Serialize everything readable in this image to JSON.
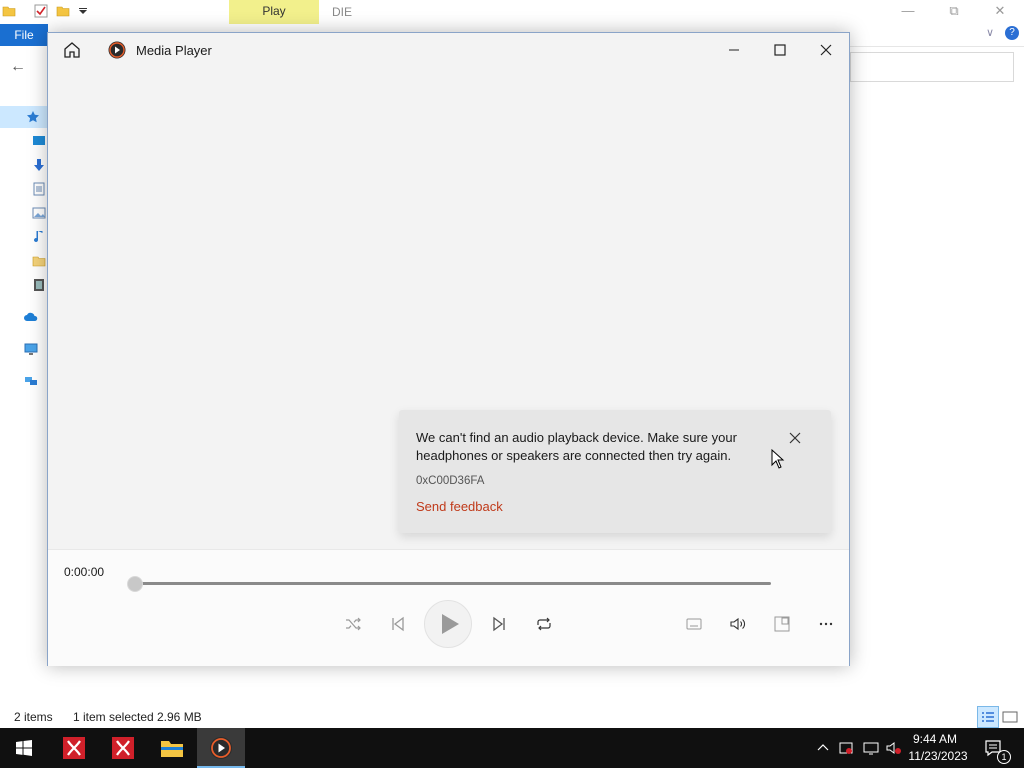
{
  "explorer": {
    "ribbon_context_tab": "Play",
    "title": "DIE",
    "file_tab": "File",
    "status": {
      "item_count": "2 items",
      "selection": "1 item selected",
      "size": "2.96 MB"
    }
  },
  "media_player": {
    "title": "Media Player",
    "error": {
      "message": "We can't find an audio playback device. Make sure your headphones or speakers are connected then try again.",
      "code": "0xC00D36FA",
      "feedback_link": "Send feedback"
    },
    "playback": {
      "time": "0:00:00",
      "progress": 0
    }
  },
  "taskbar": {
    "clock_time": "9:44 AM",
    "clock_date": "11/23/2023",
    "notification_count": "1"
  },
  "colors": {
    "accent": "#1a6fd1",
    "error_link": "#c03a1a",
    "taskbar": "#101010"
  }
}
